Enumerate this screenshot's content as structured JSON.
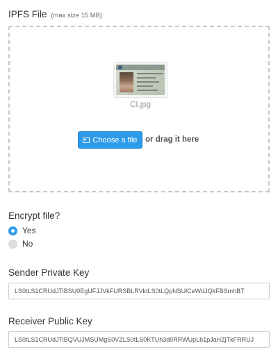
{
  "upload": {
    "title": "IPFS File",
    "size_hint": "(max size 15 MB)",
    "file_name": "CI.jpg",
    "choose_label": "Choose a file",
    "drag_label": "or drag it here"
  },
  "encrypt": {
    "label": "Encrypt file?",
    "options": [
      {
        "label": "Yes",
        "selected": true
      },
      {
        "label": "No",
        "selected": false
      }
    ]
  },
  "sender": {
    "label": "Sender Private Key",
    "value": "LS0tLS1CRUdJTiBSU0EgUFJJVkFURSBLRVktLS0tLQpNSUlCeWdJQkFBSmhBT"
  },
  "receiver": {
    "label": "Receiver Public Key",
    "value": "LS0tLS1CRUdJTiBQVUJMSUMgS0VZLS0tLS0KTUh3d0RRWUpLb1pJaHZjTkFRRUJ"
  },
  "colors": {
    "accent": "#2e9bea",
    "dropzone_border": "#c8c8c8"
  },
  "icons": {
    "choose_button": "image-icon"
  }
}
